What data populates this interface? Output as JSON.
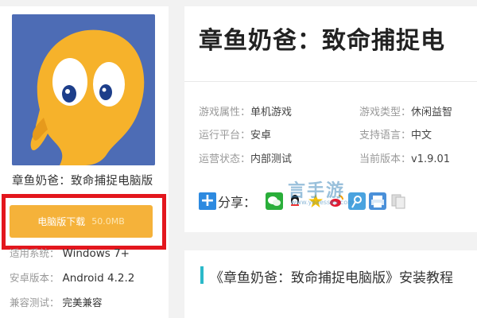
{
  "app": {
    "name": "章鱼奶爸：致命捕捉电脑版",
    "download_label": "电脑版下载",
    "download_size": "50.0MB",
    "info": [
      {
        "key": "适用系统：",
        "value": "Windows 7+"
      },
      {
        "key": "安卓版本：",
        "value": "Android 4.2.2"
      },
      {
        "key": "兼容测试：",
        "value": "完美兼容"
      }
    ]
  },
  "detail": {
    "title": "章鱼奶爸：致命捕捉电",
    "attributes": [
      {
        "key": "游戏属性：",
        "value": "单机游戏"
      },
      {
        "key": "游戏类型：",
        "value": "休闲益智"
      },
      {
        "key": "运行平台：",
        "value": "安卓"
      },
      {
        "key": "支持语言：",
        "value": "中文"
      },
      {
        "key": "运营状态：",
        "value": "内部测试"
      },
      {
        "key": "当前版本：",
        "value": "v1.9.01"
      }
    ],
    "share_label": "分享：",
    "share_icons": [
      "wechat-icon",
      "qq-icon",
      "qzone-icon",
      "weibo-icon",
      "tencent-weibo-icon",
      "print-icon",
      "copy-icon"
    ]
  },
  "watermark": {
    "main": "言手游",
    "url": "www.yeaesseu.com"
  },
  "guide": {
    "title": "《章鱼奶爸：致命捕捉电脑版》安装教程"
  },
  "colors": {
    "download_button": "#f5b23a",
    "highlight_border": "#e3161d",
    "icon_background": "#4d6cb5",
    "guide_accent": "#2bb9c9"
  }
}
